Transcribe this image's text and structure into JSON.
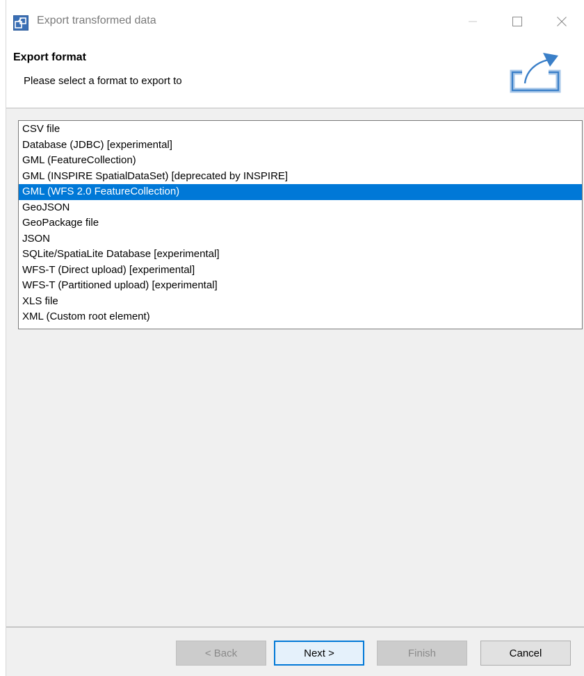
{
  "window": {
    "title": "Export transformed data",
    "app_icon": "dialog-app-icon",
    "controls": [
      "minimize-icon",
      "maximize-icon",
      "close-icon"
    ]
  },
  "header": {
    "title": "Export format",
    "description": "Please select a format to export to",
    "icon": "export-icon"
  },
  "format_list": {
    "selected_index": 4,
    "items": [
      "CSV file",
      "Database (JDBC) [experimental]",
      "GML (FeatureCollection)",
      "GML (INSPIRE SpatialDataSet) [deprecated by INSPIRE]",
      "GML (WFS 2.0 FeatureCollection)",
      "GeoJSON",
      "GeoPackage file",
      "JSON",
      "SQLite/SpatiaLite Database [experimental]",
      "WFS-T (Direct upload) [experimental]",
      "WFS-T (Partitioned upload) [experimental]",
      "XLS file",
      "XML (Custom root element)"
    ]
  },
  "buttons": {
    "back": "< Back",
    "next": "Next >",
    "finish": "Finish",
    "cancel": "Cancel"
  },
  "colors": {
    "selection": "#0078d7",
    "dialog_bg": "#f0f0f0",
    "header_bg": "#ffffff",
    "icon_blue": "#3a7fc8"
  }
}
